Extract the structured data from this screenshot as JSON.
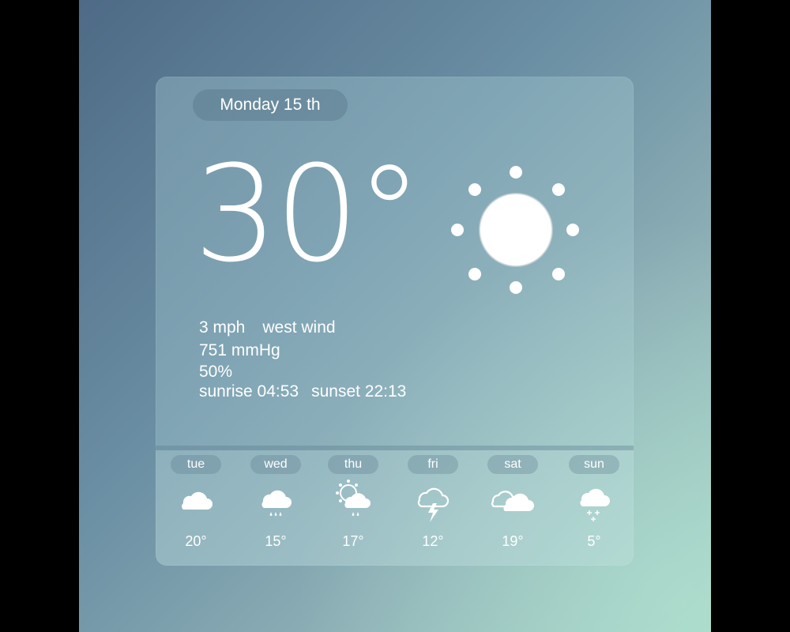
{
  "date": "Monday 15 th",
  "current": {
    "temperature": "30°",
    "condition_icon": "sun-icon",
    "wind_speed": "3 mph",
    "wind_direction": "west wind",
    "pressure": "751 mmHg",
    "humidity": "50%",
    "sunrise": "sunrise 04:53",
    "sunset": "sunset 22:13"
  },
  "forecast": [
    {
      "day": "tue",
      "temp": "20°",
      "icon": "cloud-icon"
    },
    {
      "day": "wed",
      "temp": "15°",
      "icon": "rain-cloud-icon"
    },
    {
      "day": "thu",
      "temp": "17°",
      "icon": "sun-cloud-rain-icon"
    },
    {
      "day": "fri",
      "temp": "12°",
      "icon": "thunderstorm-icon"
    },
    {
      "day": "sat",
      "temp": "19°",
      "icon": "two-clouds-icon"
    },
    {
      "day": "sun",
      "temp": "5°",
      "icon": "snow-cloud-icon"
    }
  ],
  "colors": {
    "background_start": "#4e6a86",
    "background_end": "#a6d4c8",
    "text": "#ffffff"
  }
}
